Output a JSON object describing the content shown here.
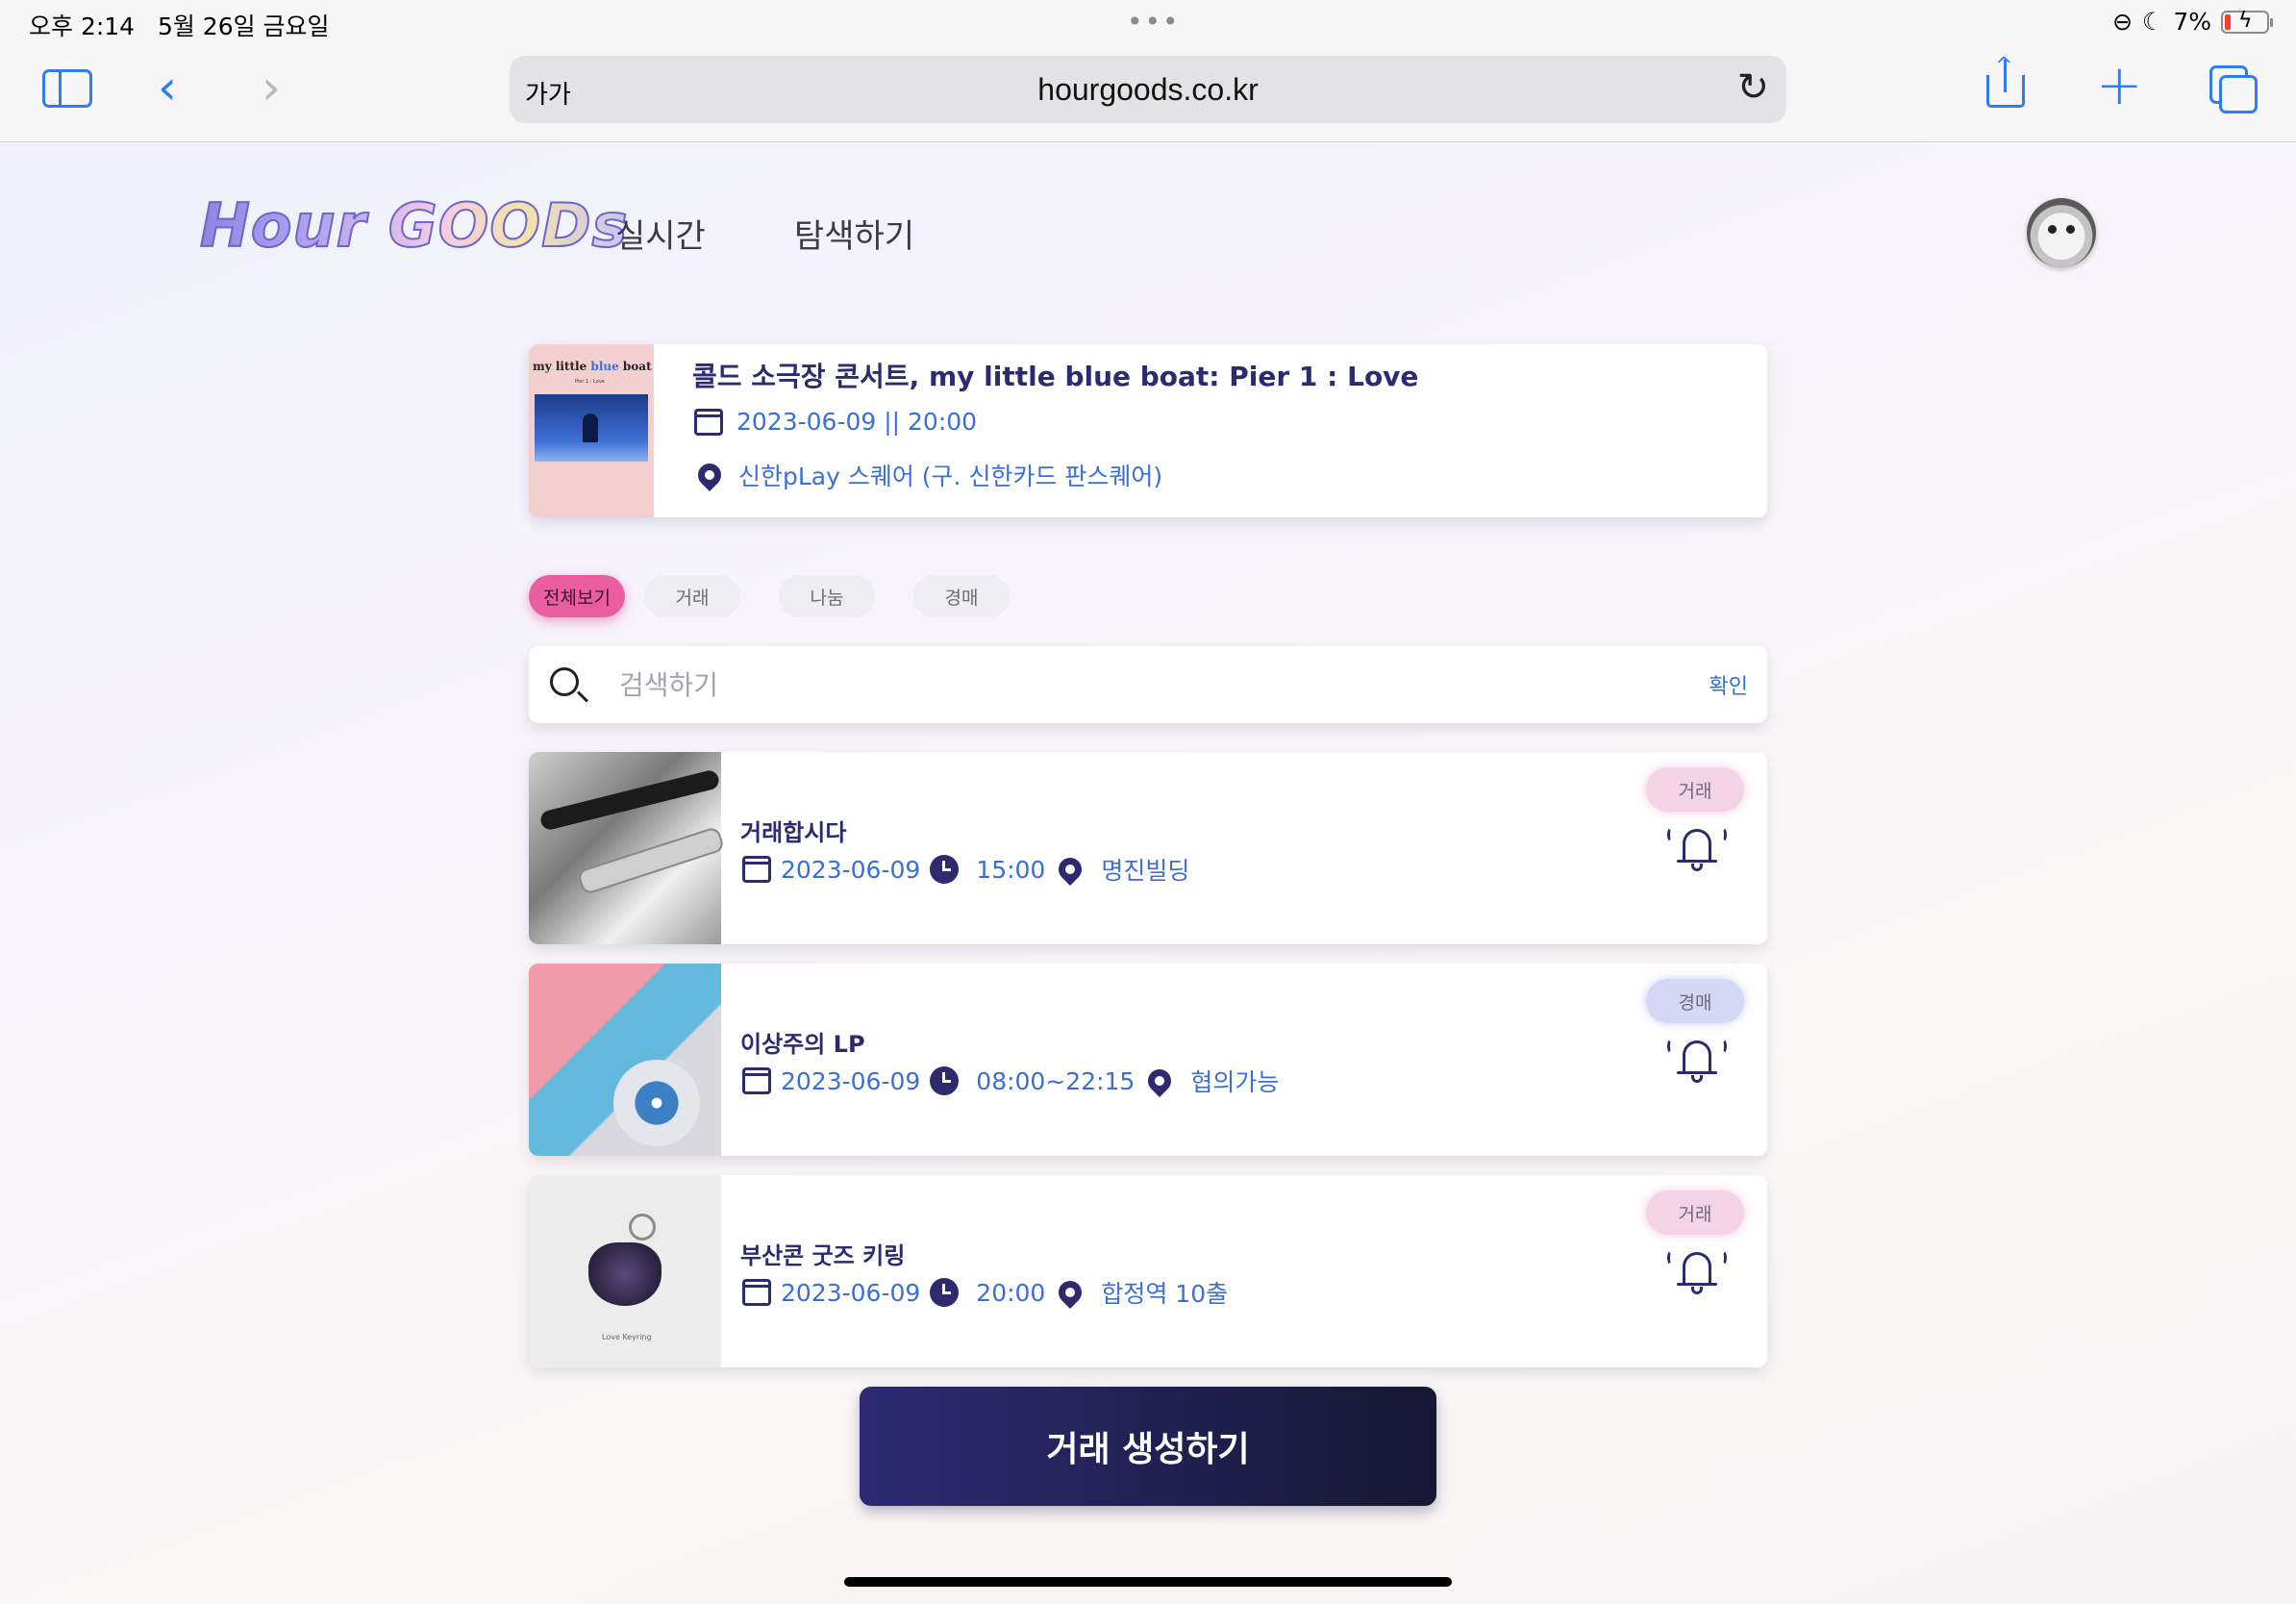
{
  "status_bar": {
    "time": "오후 2:14",
    "date": "5월 26일 금요일",
    "battery": "7%"
  },
  "browser": {
    "reader_label": "가가",
    "url": "hourgoods.co.kr"
  },
  "site": {
    "logo": "Hour GOODs",
    "nav": [
      "실시간",
      "탐색하기"
    ]
  },
  "concert": {
    "title": "콜드 소극장 콘서트, my little blue boat: Pier 1 : Love",
    "datetime": "2023-06-09 || 20:00",
    "venue": "신한pLay 스퀘어 (구. 신한카드 판스퀘어)",
    "poster_title_a": "my little ",
    "poster_title_b": "blue",
    "poster_title_c": " boat",
    "poster_sub": "Pier 1 : Love"
  },
  "filters": [
    "전체보기",
    "거래",
    "나눔",
    "경매"
  ],
  "active_filter": "전체보기",
  "search": {
    "placeholder": "검색하기",
    "confirm": "확인"
  },
  "listings": [
    {
      "title": "거래합시다",
      "date": "2023-06-09",
      "time": "15:00",
      "location": "명진빌딩",
      "type": "거래"
    },
    {
      "title": "이상주의 LP",
      "date": "2023-06-09",
      "time": "08:00~22:15",
      "location": "협의가능",
      "type": "경매"
    },
    {
      "title": "부산콘 굿즈 키링",
      "date": "2023-06-09",
      "time": "20:00",
      "location": "합정역 10출",
      "type": "거래",
      "thumb_label": "Love Keyring"
    }
  ],
  "create_button": "거래 생성하기",
  "colors": {
    "primary": "#2d2a6e",
    "link": "#3b6fd6",
    "active_chip": "#e85ea0",
    "trade_badge": "#f5d3e6",
    "auction_badge": "#d6d6f7"
  }
}
